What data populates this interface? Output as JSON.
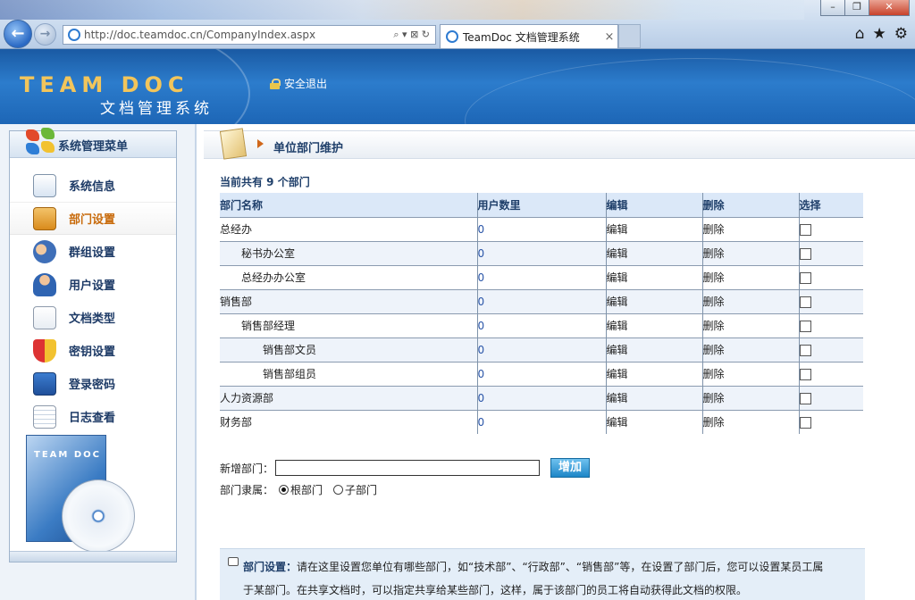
{
  "browser": {
    "url": "http://doc.teamdoc.cn/CompanyIndex.aspx",
    "tab_title": "TeamDoc 文档管理系统",
    "tab_close": "×",
    "addr_controls": "⌕ ▾ ⊠ ↻",
    "win_min": "–",
    "win_max": "❐",
    "win_close": "✕",
    "home_icon": "⌂",
    "star_icon": "★",
    "gear_icon": "⚙"
  },
  "header": {
    "brand": "TEAM DOC",
    "subtitle": "文档管理系统",
    "logout": "安全退出"
  },
  "sidebar": {
    "title": "系统管理菜单",
    "items": [
      {
        "label": "系统信息",
        "icon": "monitor-icon",
        "active": false
      },
      {
        "label": "部门设置",
        "icon": "org-chart-icon",
        "active": true
      },
      {
        "label": "群组设置",
        "icon": "group-icon",
        "active": false
      },
      {
        "label": "用户设置",
        "icon": "user-icon",
        "active": false
      },
      {
        "label": "文档类型",
        "icon": "document-icon",
        "active": false
      },
      {
        "label": "密钥设置",
        "icon": "shield-icon",
        "active": false
      },
      {
        "label": "登录密码",
        "icon": "laptop-icon",
        "active": false
      },
      {
        "label": "日志查看",
        "icon": "notepad-icon",
        "active": false
      }
    ],
    "product_label": "TEAM DOC"
  },
  "main": {
    "panel_title": "单位部门维护",
    "summary": "当前共有 9 个部门",
    "columns": [
      "部门名称",
      "用户数里",
      "编辑",
      "删除",
      "选择"
    ],
    "rows": [
      {
        "name": "总经办",
        "level": 0,
        "count": "0",
        "edit": "编辑",
        "delete": "删除"
      },
      {
        "name": "秘书办公室",
        "level": 1,
        "count": "0",
        "edit": "编辑",
        "delete": "删除"
      },
      {
        "name": "总经办办公室",
        "level": 1,
        "count": "0",
        "edit": "编辑",
        "delete": "删除"
      },
      {
        "name": "销售部",
        "level": 0,
        "count": "0",
        "edit": "编辑",
        "delete": "删除"
      },
      {
        "name": "销售部经理",
        "level": 1,
        "count": "0",
        "edit": "编辑",
        "delete": "删除"
      },
      {
        "name": "销售部文员",
        "level": 2,
        "count": "0",
        "edit": "编辑",
        "delete": "删除"
      },
      {
        "name": "销售部组员",
        "level": 2,
        "count": "0",
        "edit": "编辑",
        "delete": "删除"
      },
      {
        "name": "人力资源部",
        "level": 0,
        "count": "0",
        "edit": "编辑",
        "delete": "删除"
      },
      {
        "name": "财务部",
        "level": 0,
        "count": "0",
        "edit": "编辑",
        "delete": "删除"
      }
    ],
    "add_label": "新增部门：",
    "add_value": "",
    "add_button": "增加",
    "belong_label": "部门隶属：",
    "radio_root": "根部门",
    "radio_child": "子部门",
    "radio_selected": "root",
    "help_title": "部门设置：",
    "help_text": "请在这里设置您单位有哪些部门，如“技术部”、“行政部”、“销售部”等，在设置了部门后，您可以设置某员工属",
    "help_text2": "于某部门。在共享文档时，可以指定共享给某些部门，这样，属于该部门的员工将自动获得此文档的权限。"
  },
  "colors": {
    "header_blue": "#1d66b6",
    "accent_orange": "#c86a0a",
    "link_blue": "#2a55a8",
    "nav_text": "#1d3a66"
  }
}
